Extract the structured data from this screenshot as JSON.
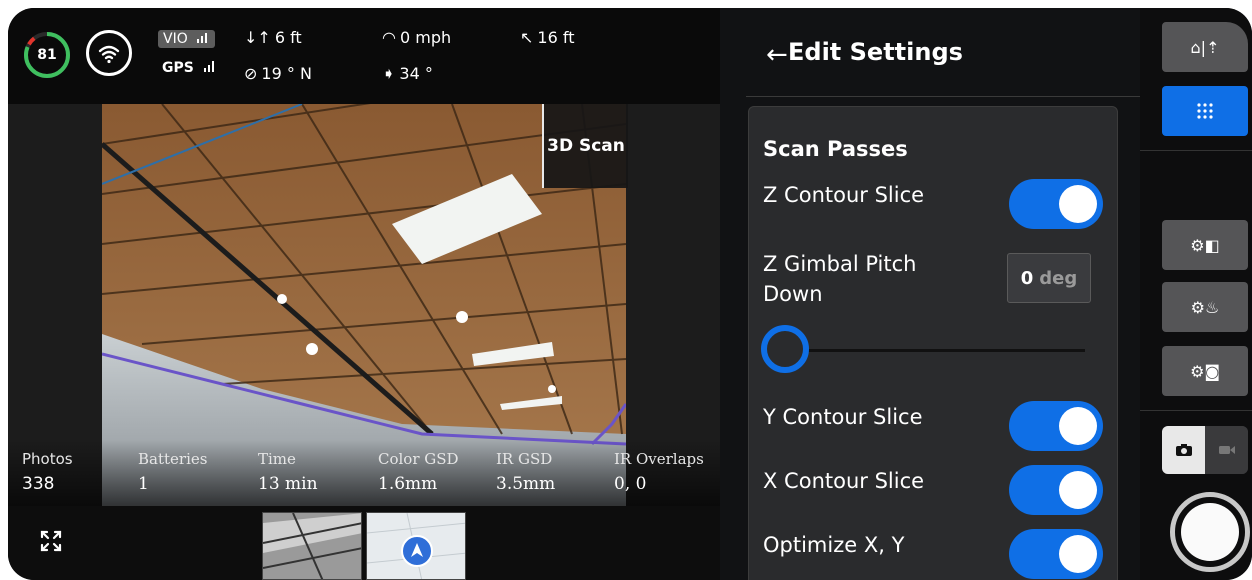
{
  "telemetry": {
    "battery_percent": "81",
    "vio_label": "VIO",
    "gps_label": "GPS",
    "altitude": "6 ft",
    "heading": "19 ° N",
    "speed": "0 mph",
    "gimbal_angle": "34 °",
    "distance": "16 ft"
  },
  "camera": {
    "mode_badge": "3D Scan"
  },
  "stats": [
    {
      "label": "Photos",
      "value": "338"
    },
    {
      "label": "Batteries",
      "value": "1"
    },
    {
      "label": "Time",
      "value": "13 min"
    },
    {
      "label": "Color GSD",
      "value": "1.6mm"
    },
    {
      "label": "IR GSD",
      "value": "3.5mm"
    },
    {
      "label": "IR Overlaps",
      "value": "0, 0"
    }
  ],
  "panel": {
    "title": "Edit Settings",
    "section_title": "Scan Passes",
    "z_contour_label": "Z Contour Slice",
    "z_gimbal_label_line1": "Z Gimbal Pitch",
    "z_gimbal_label_line2": "Down",
    "z_gimbal_value": "0",
    "z_gimbal_unit": "deg",
    "y_contour_label": "Y Contour Slice",
    "x_contour_label": "X Contour Slice",
    "optimize_label": "Optimize X, Y",
    "z_contour_on": true,
    "y_contour_on": true,
    "x_contour_on": true,
    "optimize_on": true,
    "gimbal_slider_level": 0
  },
  "rail": {
    "icons": [
      "home-altitude-icon",
      "grid-menu-icon",
      "map-settings-icon",
      "fire-settings-icon",
      "camera-settings-icon",
      "photo-mode-icon",
      "video-mode-icon",
      "shutter-button"
    ],
    "active_mode": "photo"
  },
  "colors": {
    "accent_blue": "#0f6fe6",
    "battery_green": "#3fbf5f",
    "battery_red": "#e0342c"
  }
}
